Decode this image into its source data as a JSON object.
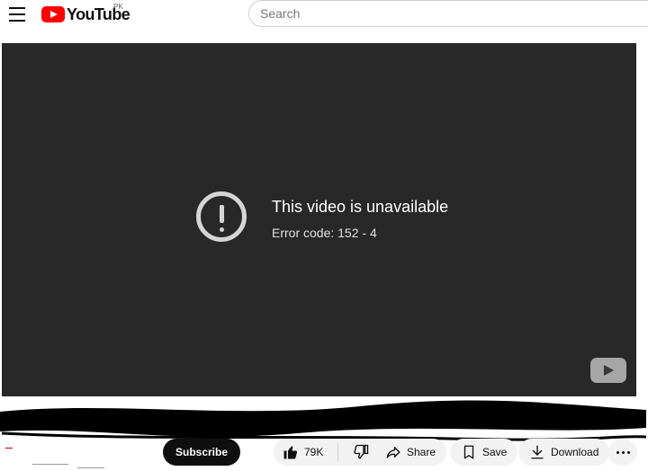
{
  "header": {
    "logo_text": "YouTube",
    "region": "PK",
    "search_placeholder": "Search"
  },
  "player": {
    "error_title": "This video is unavailable",
    "error_code": "Error code: 152 - 4"
  },
  "actions": {
    "subscribe": "Subscribe",
    "likes": "79K",
    "share": "Share",
    "save": "Save",
    "download": "Download"
  },
  "icons": {
    "menu": "menu-icon",
    "error": "error-icon",
    "like": "thumbs-up-icon",
    "dislike": "thumbs-down-icon",
    "share": "share-arrow-icon",
    "save": "bookmark-icon",
    "download": "download-icon",
    "more": "more-dots-icon"
  },
  "colors": {
    "brand": "#ff0000",
    "player_bg": "#282828",
    "subscribe_bg": "#0f0f0f",
    "pill_bg": "#f2f2f2"
  }
}
